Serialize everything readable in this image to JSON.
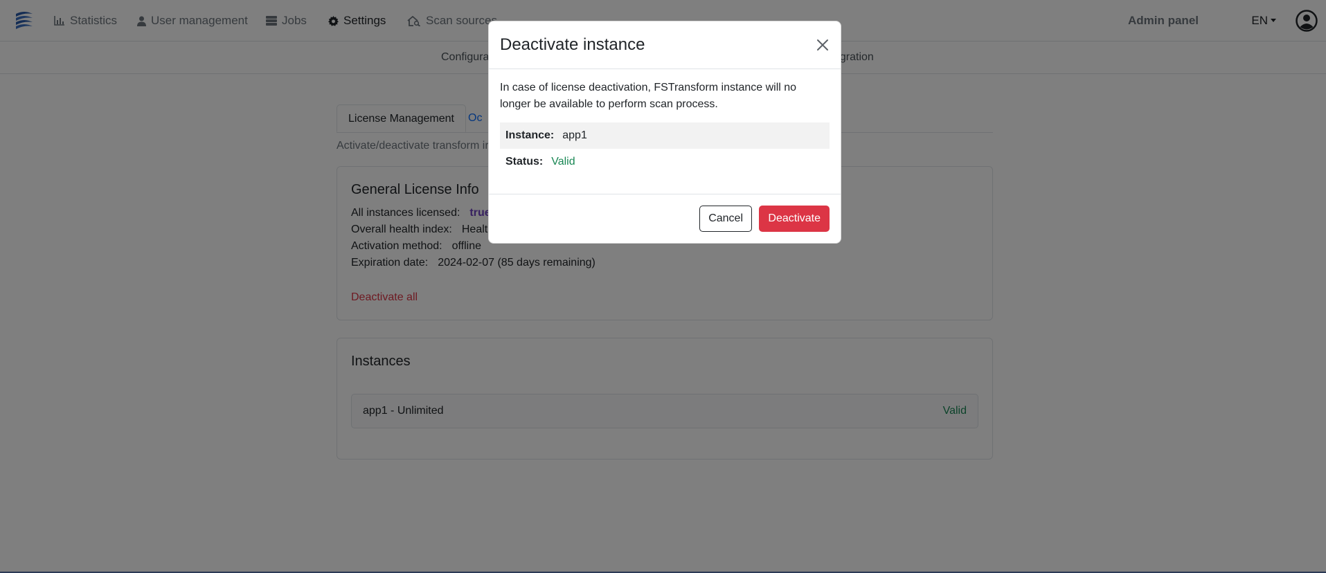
{
  "navbar": {
    "items": [
      {
        "label": "Statistics",
        "icon": "bar-chart-icon"
      },
      {
        "label": "User management",
        "icon": "user-icon"
      },
      {
        "label": "Jobs",
        "icon": "server-stack-icon"
      },
      {
        "label": "Settings",
        "icon": "gear-icon"
      },
      {
        "label": "Scan sources",
        "icon": "home-search-icon"
      }
    ],
    "admin_label": "Admin panel",
    "language": "EN"
  },
  "subnav": {
    "left": "Configura",
    "right": "egration"
  },
  "tabs": {
    "active": "License Management",
    "other": "Oc"
  },
  "subtitle": "Activate/deactivate transform ir",
  "general_card": {
    "title": "General License Info",
    "rows": [
      {
        "label": "All instances licensed:",
        "value": "true"
      },
      {
        "label": "Overall health index:",
        "value": "Healt"
      },
      {
        "label": "Activation method:",
        "value": "offline"
      },
      {
        "label": "Expiration date:",
        "value": "2024-02-07 (85 days remaining)"
      }
    ],
    "deactivate_all": "Deactivate all"
  },
  "instances_card": {
    "title": "Instances",
    "items": [
      {
        "name": "app1 - Unlimited",
        "status": "Valid"
      }
    ]
  },
  "modal": {
    "title": "Deactivate instance",
    "description": "In case of license deactivation, FSTransform instance will no longer be available to perform scan process.",
    "instance_label": "Instance:",
    "instance_value": "app1",
    "status_label": "Status:",
    "status_value": "Valid",
    "cancel_label": "Cancel",
    "deactivate_label": "Deactivate"
  },
  "colors": {
    "danger": "#dc3545",
    "success": "#198754",
    "link": "#0d6efd",
    "backdrop": "rgba(0,0,0,0.5)"
  }
}
